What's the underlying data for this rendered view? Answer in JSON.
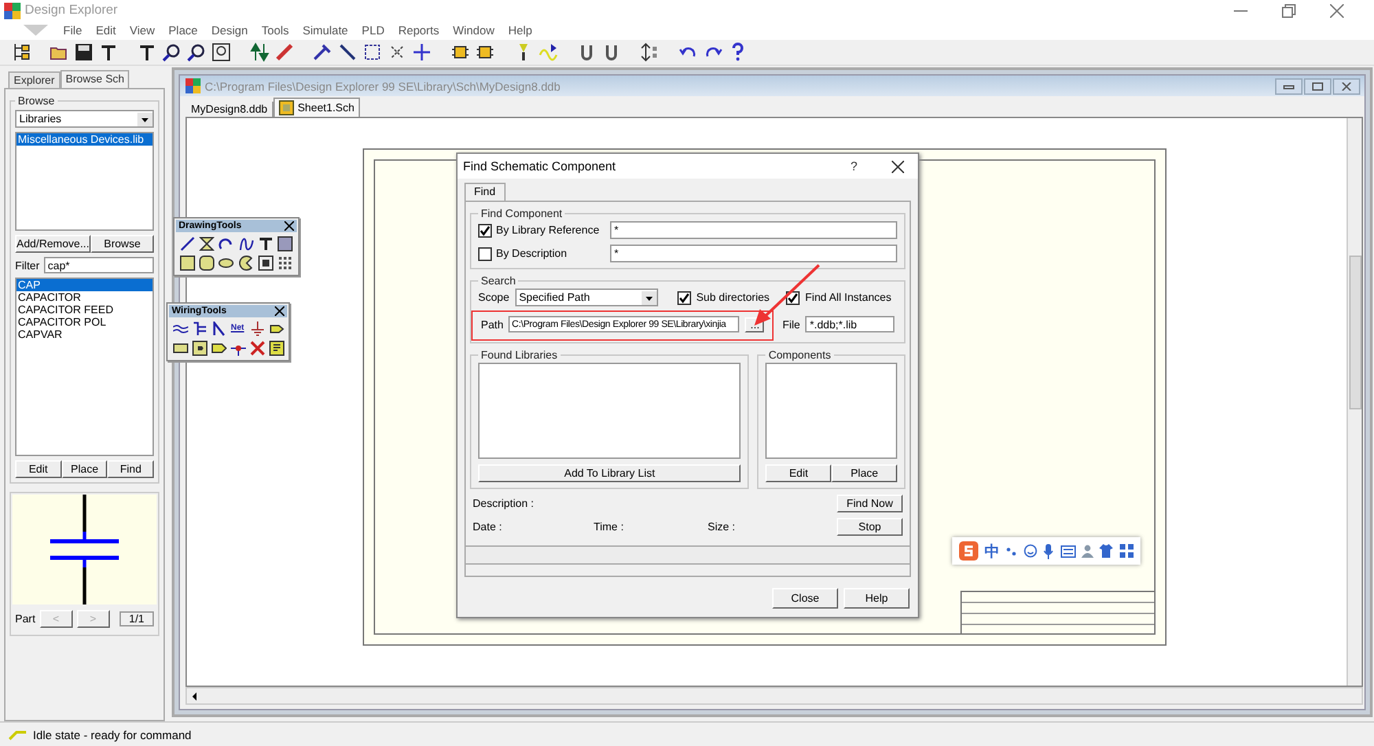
{
  "app": {
    "title": "Design Explorer"
  },
  "menu": [
    "File",
    "Edit",
    "View",
    "Place",
    "Design",
    "Tools",
    "Simulate",
    "PLD",
    "Reports",
    "Window",
    "Help"
  ],
  "side_panel": {
    "tabs": [
      {
        "label": "Explorer",
        "selected": false
      },
      {
        "label": "Browse Sch",
        "selected": true
      }
    ],
    "browse_group": "Browse",
    "browse_type": "Libraries",
    "libraries": [
      {
        "name": "Miscellaneous Devices.lib",
        "selected": true
      }
    ],
    "library_buttons": [
      "Add/Remove...",
      "Browse"
    ],
    "filter_label": "Filter",
    "filter_value": "cap*",
    "components": [
      {
        "name": "CAP",
        "selected": true
      },
      {
        "name": "CAPACITOR",
        "selected": false
      },
      {
        "name": "CAPACITOR FEED",
        "selected": false
      },
      {
        "name": "CAPACITOR POL",
        "selected": false
      },
      {
        "name": "CAPVAR",
        "selected": false
      }
    ],
    "component_buttons": [
      "Edit",
      "Place",
      "Find"
    ],
    "part_label": "Part",
    "part_prev": "<",
    "part_next": ">",
    "part_count": "1/1"
  },
  "document": {
    "path": "C:\\Program Files\\Design Explorer 99 SE\\Library\\Sch\\MyDesign8.ddb",
    "tabs": [
      {
        "label": "MyDesign8.ddb",
        "selected": false
      },
      {
        "label": "Sheet1.Sch",
        "selected": true
      }
    ]
  },
  "drawing_tools": {
    "title": "DrawingTools"
  },
  "wiring_tools": {
    "title": "WiringTools",
    "net_label": "Net"
  },
  "dialog": {
    "title": "Find Schematic Component",
    "help": "?",
    "tabs": [
      {
        "label": "Find",
        "selected": true
      }
    ],
    "find_group": "Find Component",
    "by_reference": {
      "label": "By Library Reference",
      "checked": true,
      "value": "*"
    },
    "by_description": {
      "label": "By Description",
      "checked": false,
      "value": "*"
    },
    "search_group": "Search",
    "scope_label": "Scope",
    "scope_value": "Specified Path",
    "sub_directories": {
      "label": "Sub directories",
      "checked": true
    },
    "find_all_instances": {
      "label": "Find All Instances",
      "checked": true
    },
    "path_label": "Path",
    "path_value": "C:\\Program Files\\Design Explorer 99 SE\\Library\\xinjia",
    "browse_button": "...",
    "file_label": "File",
    "file_value": "*.ddb;*.lib",
    "found_libraries": "Found Libraries",
    "components": "Components",
    "add_button": "Add To Library List",
    "edit_button": "Edit",
    "place_button": "Place",
    "description_label": "Description :",
    "date_label": "Date :",
    "time_label": "Time :",
    "size_label": "Size :",
    "find_now_button": "Find Now",
    "stop_button": "Stop",
    "close_button": "Close",
    "help_button": "Help"
  },
  "ime_bar": {
    "label": "中"
  },
  "status_bar": "Idle state - ready for command"
}
